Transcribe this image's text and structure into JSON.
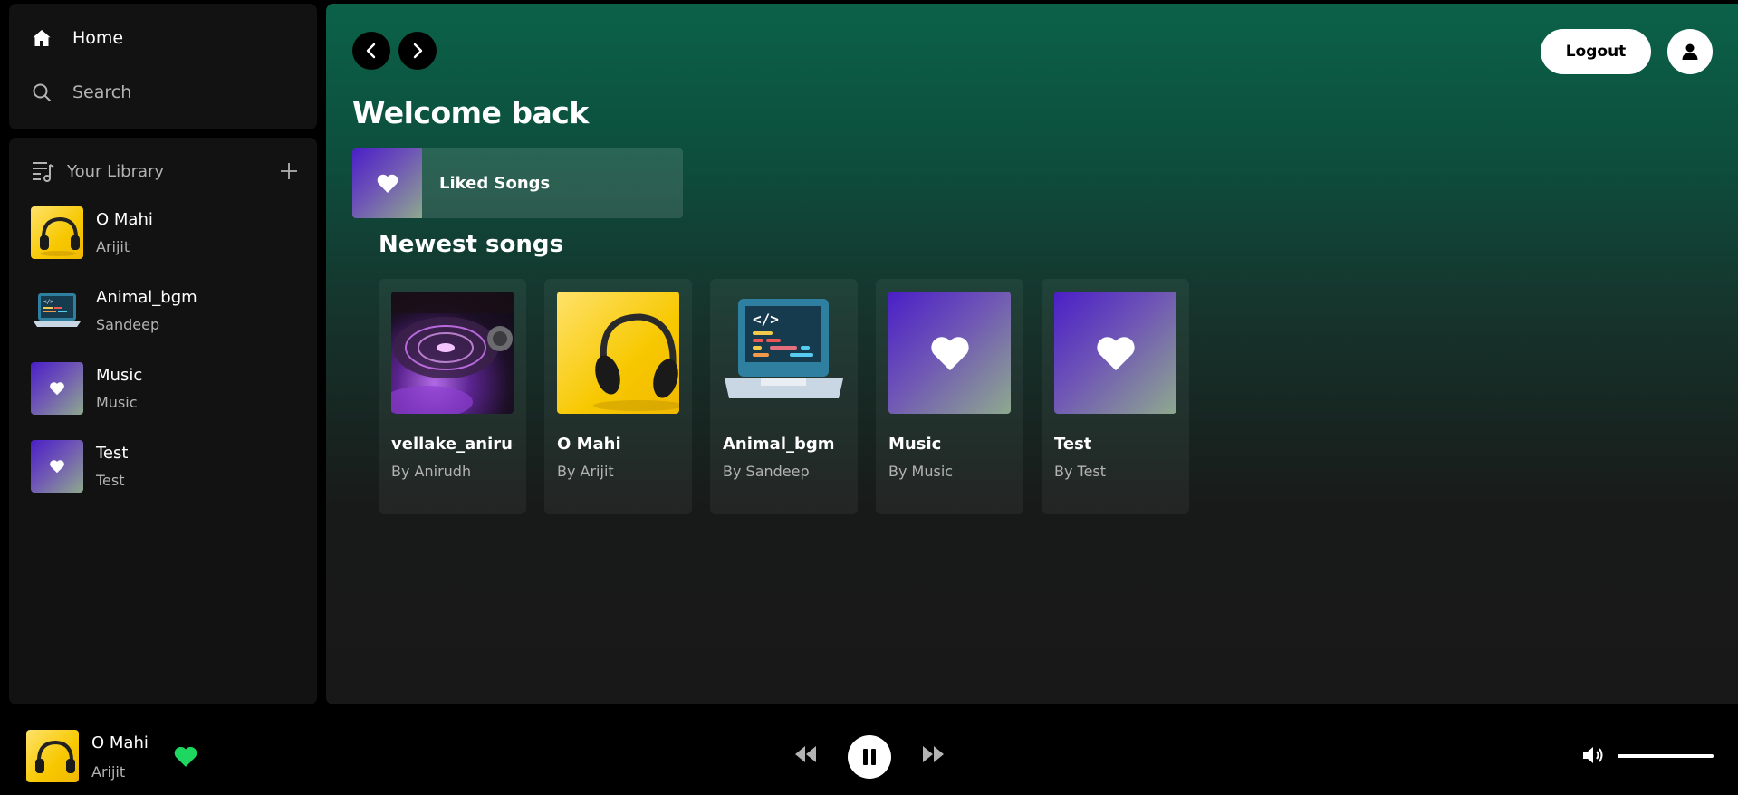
{
  "nav": {
    "home_label": "Home",
    "search_label": "Search"
  },
  "library": {
    "title": "Your Library",
    "items": [
      {
        "name": "O Mahi",
        "artist": "Arijit",
        "art": "headphones"
      },
      {
        "name": "Animal_bgm",
        "artist": "Sandeep",
        "art": "laptop"
      },
      {
        "name": "Music",
        "artist": "Music",
        "art": "heart"
      },
      {
        "name": "Test",
        "artist": "Test",
        "art": "heart"
      }
    ]
  },
  "header": {
    "logout_label": "Logout"
  },
  "main": {
    "welcome": "Welcome back",
    "liked_songs": "Liked Songs",
    "newest_title": "Newest songs",
    "songs": [
      {
        "name": "vellake_anirudh",
        "by": "By Anirudh",
        "art": "disc"
      },
      {
        "name": "O Mahi",
        "by": "By Arijit",
        "art": "headphones"
      },
      {
        "name": "Animal_bgm",
        "by": "By Sandeep",
        "art": "laptop"
      },
      {
        "name": "Music",
        "by": "By Music",
        "art": "heart"
      },
      {
        "name": "Test",
        "by": "By Test",
        "art": "heart"
      }
    ]
  },
  "player": {
    "title": "O Mahi",
    "artist": "Arijit",
    "liked": true,
    "state": "playing",
    "volume": 1.0,
    "liked_color": "#1ed760"
  },
  "colors": {
    "accent": "#1ed760",
    "main_gradient_top": "#0b6248",
    "panel_bg": "#121212"
  }
}
